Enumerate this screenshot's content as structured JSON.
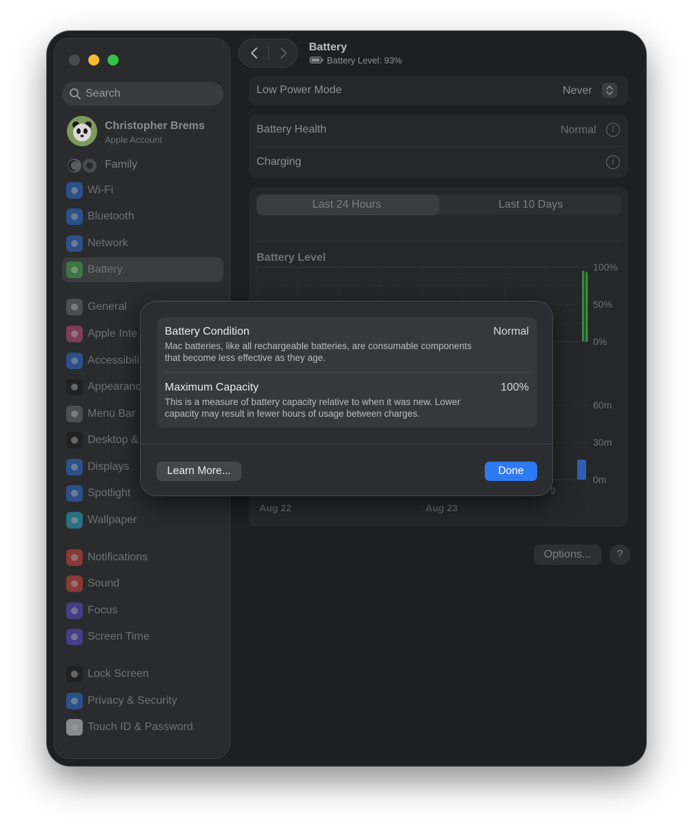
{
  "window": {
    "title": "Battery",
    "subtitle": "Battery Level: 93%"
  },
  "sidebar": {
    "search_placeholder": "Search",
    "account": {
      "name": "Christopher Brems",
      "subtitle": "Apple Account"
    },
    "family_label": "Family",
    "items": [
      {
        "label": "Wi-Fi",
        "icon": "wifi-icon",
        "color": "#2f6fd6"
      },
      {
        "label": "Bluetooth",
        "icon": "bluetooth-icon",
        "color": "#2f6fd6"
      },
      {
        "label": "Network",
        "icon": "globe-icon",
        "color": "#2f6fd6"
      },
      {
        "label": "Battery",
        "icon": "battery-icon",
        "color": "#3ea84a",
        "selected": true
      },
      {
        "label": "General",
        "icon": "gear-icon",
        "color": "#6b6c6e"
      },
      {
        "label": "Apple Inte",
        "icon": "apple-intelligence-icon",
        "color": "#c0507a"
      },
      {
        "label": "Accessibili",
        "icon": "accessibility-icon",
        "color": "#2f6fd6"
      },
      {
        "label": "Appearanc",
        "icon": "appearance-icon",
        "color": "#1a1a1a"
      },
      {
        "label": "Menu Bar",
        "icon": "menu-bar-icon",
        "color": "#6b6c6e"
      },
      {
        "label": "Desktop &",
        "icon": "desktop-dock-icon",
        "color": "#1a1a1a"
      },
      {
        "label": "Displays",
        "icon": "sun-icon",
        "color": "#2f6fd6"
      },
      {
        "label": "Spotlight",
        "icon": "magnifier-icon",
        "color": "#2f6fd6"
      },
      {
        "label": "Wallpaper",
        "icon": "flower-icon",
        "color": "#2aa9c4"
      },
      {
        "label": "Notifications",
        "icon": "bell-icon",
        "color": "#d8453e"
      },
      {
        "label": "Sound",
        "icon": "speaker-icon",
        "color": "#d8453e"
      },
      {
        "label": "Focus",
        "icon": "moon-icon",
        "color": "#5a4fcf"
      },
      {
        "label": "Screen Time",
        "icon": "hourglass-icon",
        "color": "#5a4fcf"
      },
      {
        "label": "Lock Screen",
        "icon": "lock-icon",
        "color": "#1a1a1a"
      },
      {
        "label": "Privacy & Security",
        "icon": "hand-icon",
        "color": "#2f6fd6"
      },
      {
        "label": "Touch ID & Password",
        "icon": "fingerprint-icon",
        "color": "#d8d8d8"
      }
    ]
  },
  "content": {
    "low_power": {
      "label": "Low Power Mode",
      "value": "Never"
    },
    "health": {
      "label": "Battery Health",
      "value": "Normal"
    },
    "charging": {
      "label": "Charging"
    },
    "tabs": [
      "Last 24 Hours",
      "Last 10 Days"
    ],
    "options_label": "Options...",
    "help_label": "?"
  },
  "chart_data": [
    {
      "type": "bar",
      "title": "Battery Level",
      "y_ticks": [
        "100%",
        "50%",
        "0%"
      ],
      "ylim": [
        0,
        100
      ],
      "values": [
        95,
        93
      ],
      "color": "#3ea84a"
    },
    {
      "type": "bar",
      "y_ticks": [
        "60m",
        "30m",
        "0m"
      ],
      "ylim": [
        0,
        60
      ],
      "values": [
        16
      ],
      "color": "#2f6fd6",
      "x_labels": [
        "Aug 22",
        "Aug 23"
      ],
      "partial_tick": "9"
    }
  ],
  "modal": {
    "condition": {
      "title": "Battery Condition",
      "value": "Normal",
      "desc": "Mac batteries, like all rechargeable batteries, are consumable components that become less effective as they age."
    },
    "capacity": {
      "title": "Maximum Capacity",
      "value": "100%",
      "desc": "This is a measure of battery capacity relative to when it was new. Lower capacity may result in fewer hours of usage between charges."
    },
    "learn_more": "Learn More...",
    "done": "Done"
  }
}
